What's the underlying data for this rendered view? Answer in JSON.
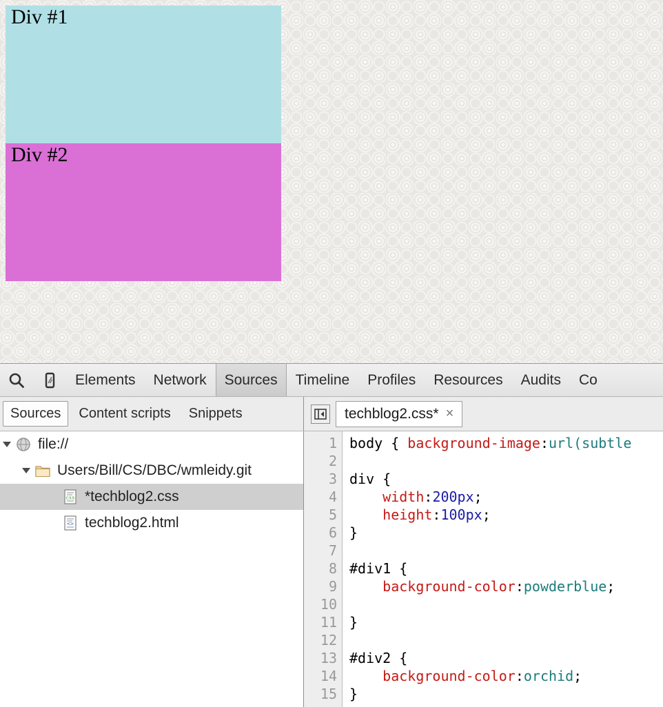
{
  "page": {
    "div1_label": "Div #1",
    "div2_label": "Div #2",
    "div1_color": "#b0e0e6",
    "div2_color": "#da70d6",
    "background_base": "#e9e7e3"
  },
  "devtools": {
    "toolbar": {
      "search_icon": "search-icon",
      "device_icon": "device-toggle-icon",
      "tabs": [
        {
          "label": "Elements",
          "active": false
        },
        {
          "label": "Network",
          "active": false
        },
        {
          "label": "Sources",
          "active": true
        },
        {
          "label": "Timeline",
          "active": false
        },
        {
          "label": "Profiles",
          "active": false
        },
        {
          "label": "Resources",
          "active": false
        },
        {
          "label": "Audits",
          "active": false
        },
        {
          "label": "Co",
          "active": false
        }
      ]
    },
    "subbar": {
      "tabs": [
        {
          "label": "Sources",
          "active": true
        },
        {
          "label": "Content scripts",
          "active": false
        },
        {
          "label": "Snippets",
          "active": false
        }
      ],
      "collapse_icon": "collapse-sidebar-icon",
      "editor_tab": {
        "label": "techblog2.css*",
        "close_label": "×"
      }
    },
    "file_tree": [
      {
        "label": "file://",
        "indent": 0,
        "icon": "globe-icon",
        "twisty": true,
        "selected": false
      },
      {
        "label": "Users/Bill/CS/DBC/wmleidy.git",
        "indent": 1,
        "icon": "folder-icon",
        "twisty": true,
        "selected": false
      },
      {
        "label": "*techblog2.css",
        "indent": 2,
        "icon": "css-file-icon",
        "twisty": false,
        "selected": true
      },
      {
        "label": "techblog2.html",
        "indent": 2,
        "icon": "html-file-icon",
        "twisty": false,
        "selected": false
      }
    ],
    "editor": {
      "line_numbers": [
        "1",
        "2",
        "3",
        "4",
        "5",
        "6",
        "7",
        "8",
        "9",
        "10",
        "11",
        "12",
        "13",
        "14",
        "15"
      ],
      "lines": [
        [
          {
            "t": "body { ",
            "c": "plain"
          },
          {
            "t": "background-image",
            "c": "prop"
          },
          {
            "t": ":",
            "c": "plain"
          },
          {
            "t": "url(subtle",
            "c": "kw"
          }
        ],
        [],
        [
          {
            "t": "div {",
            "c": "plain"
          }
        ],
        [
          {
            "t": "    ",
            "c": "plain"
          },
          {
            "t": "width",
            "c": "prop"
          },
          {
            "t": ":",
            "c": "plain"
          },
          {
            "t": "200px",
            "c": "val"
          },
          {
            "t": ";",
            "c": "plain"
          }
        ],
        [
          {
            "t": "    ",
            "c": "plain"
          },
          {
            "t": "height",
            "c": "prop"
          },
          {
            "t": ":",
            "c": "plain"
          },
          {
            "t": "100px",
            "c": "val"
          },
          {
            "t": ";",
            "c": "plain"
          }
        ],
        [
          {
            "t": "}",
            "c": "plain"
          }
        ],
        [],
        [
          {
            "t": "#div1 {",
            "c": "plain"
          }
        ],
        [
          {
            "t": "    ",
            "c": "plain"
          },
          {
            "t": "background-color",
            "c": "prop"
          },
          {
            "t": ":",
            "c": "plain"
          },
          {
            "t": "powderblue",
            "c": "kw"
          },
          {
            "t": ";",
            "c": "plain"
          }
        ],
        [],
        [
          {
            "t": "}",
            "c": "plain"
          }
        ],
        [],
        [
          {
            "t": "#div2 {",
            "c": "plain"
          }
        ],
        [
          {
            "t": "    ",
            "c": "plain"
          },
          {
            "t": "background-color",
            "c": "prop"
          },
          {
            "t": ":",
            "c": "plain"
          },
          {
            "t": "orchid",
            "c": "kw"
          },
          {
            "t": ";",
            "c": "plain"
          }
        ],
        [
          {
            "t": "}",
            "c": "plain"
          }
        ]
      ]
    }
  }
}
